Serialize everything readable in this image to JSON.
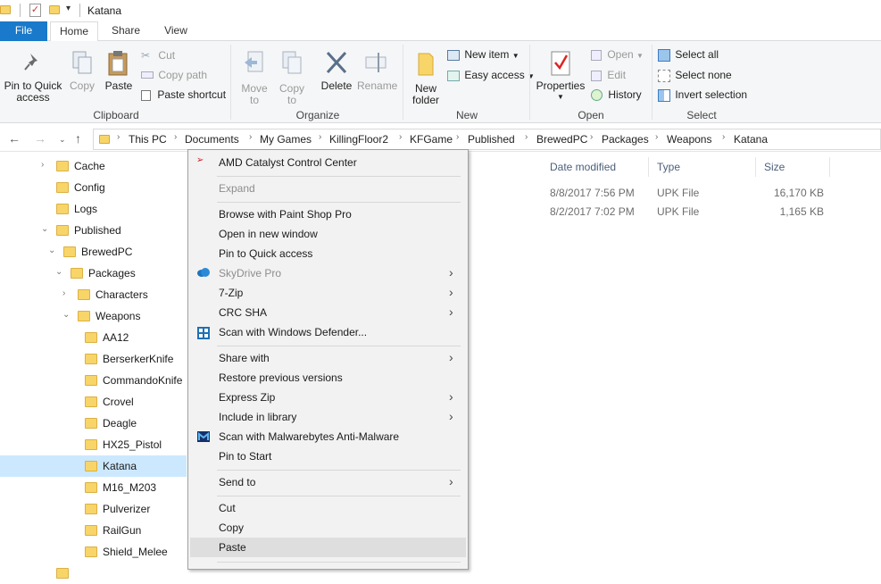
{
  "window": {
    "title": "Katana"
  },
  "ribbon_tabs": [
    "File",
    "Home",
    "Share",
    "View"
  ],
  "clipboard": {
    "group_label": "Clipboard",
    "pin_line1": "Pin to Quick",
    "pin_line2": "access",
    "copy": "Copy",
    "paste": "Paste",
    "cut": "Cut",
    "copy_path": "Copy path",
    "paste_shortcut": "Paste shortcut"
  },
  "organize": {
    "group_label": "Organize",
    "move_line1": "Move",
    "move_line2": "to",
    "copy_line1": "Copy",
    "copy_line2": "to",
    "delete": "Delete",
    "rename": "Rename"
  },
  "new": {
    "group_label": "New",
    "folder_line1": "New",
    "folder_line2": "folder",
    "new_item": "New item",
    "easy_access": "Easy access"
  },
  "open": {
    "group_label": "Open",
    "properties": "Properties",
    "open": "Open",
    "edit": "Edit",
    "history": "History"
  },
  "select": {
    "group_label": "Select",
    "select_all": "Select all",
    "select_none": "Select none",
    "invert": "Invert selection"
  },
  "breadcrumb": [
    "This PC",
    "Documents",
    "My Games",
    "KillingFloor2",
    "KFGame",
    "Published",
    "BrewedPC",
    "Packages",
    "Weapons",
    "Katana"
  ],
  "tree": [
    {
      "label": "Cache",
      "chev": "›"
    },
    {
      "label": "Config",
      "chev": ""
    },
    {
      "label": "Logs",
      "chev": ""
    },
    {
      "label": "Published",
      "chev": "⌄"
    },
    {
      "label": "BrewedPC",
      "chev": "⌄"
    },
    {
      "label": "Packages",
      "chev": "⌄"
    },
    {
      "label": "Characters",
      "chev": "›"
    },
    {
      "label": "Weapons",
      "chev": "⌄"
    },
    {
      "label": "AA12",
      "chev": ""
    },
    {
      "label": "BerserkerKnife",
      "chev": ""
    },
    {
      "label": "CommandoKnife",
      "chev": ""
    },
    {
      "label": "Crovel",
      "chev": ""
    },
    {
      "label": "Deagle",
      "chev": ""
    },
    {
      "label": "HX25_Pistol",
      "chev": ""
    },
    {
      "label": "Katana",
      "chev": ""
    },
    {
      "label": "M16_M203",
      "chev": ""
    },
    {
      "label": "Pulverizer",
      "chev": ""
    },
    {
      "label": "RailGun",
      "chev": ""
    },
    {
      "label": "Shield_Melee",
      "chev": ""
    }
  ],
  "columns": {
    "date": "Date modified",
    "type": "Type",
    "size": "Size"
  },
  "files": [
    {
      "date": "8/8/2017 7:56 PM",
      "type": "UPK File",
      "size": "16,170 KB"
    },
    {
      "date": "8/2/2017 7:02 PM",
      "type": "UPK File",
      "size": "1,165 KB"
    }
  ],
  "context_menu": [
    {
      "label": "AMD Catalyst Control Center",
      "icon": "amd-icon"
    },
    {
      "sep": true
    },
    {
      "label": "Expand",
      "disabled": true
    },
    {
      "sep": true
    },
    {
      "label": "Browse with Paint Shop Pro"
    },
    {
      "label": "Open in new window"
    },
    {
      "label": "Pin to Quick access"
    },
    {
      "label": "SkyDrive Pro",
      "disabled": true,
      "submenu": true,
      "icon": "skydrive-icon"
    },
    {
      "label": "7-Zip",
      "submenu": true
    },
    {
      "label": "CRC SHA",
      "submenu": true
    },
    {
      "label": "Scan with Windows Defender...",
      "icon": "defender-icon"
    },
    {
      "sep": true
    },
    {
      "label": "Share with",
      "submenu": true
    },
    {
      "label": "Restore previous versions"
    },
    {
      "label": "Express Zip",
      "submenu": true
    },
    {
      "label": "Include in library",
      "submenu": true
    },
    {
      "label": "Scan with Malwarebytes Anti-Malware",
      "icon": "malwarebytes-icon"
    },
    {
      "label": "Pin to Start"
    },
    {
      "sep": true
    },
    {
      "label": "Send to",
      "submenu": true
    },
    {
      "sep": true
    },
    {
      "label": "Cut"
    },
    {
      "label": "Copy"
    },
    {
      "label": "Paste",
      "highlighted": true
    },
    {
      "sep": true
    }
  ],
  "colors": {
    "file_tab": "#1979ca",
    "tree_selected": "#cce8ff",
    "menu_bg": "#f2f2f2",
    "menu_highlight": "#dedede"
  }
}
